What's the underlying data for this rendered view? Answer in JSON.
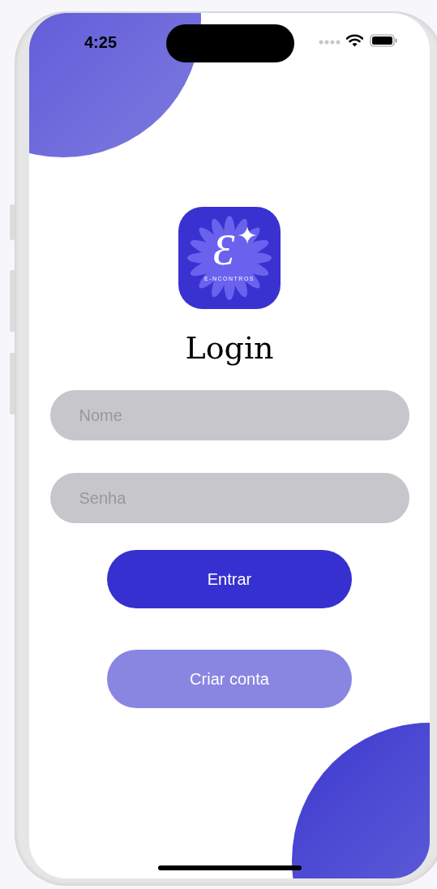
{
  "status_bar": {
    "time": "4:25"
  },
  "logo": {
    "letter": "Ɛ",
    "wordmark": "E-NCONTROS"
  },
  "title": "Login",
  "fields": [
    {
      "placeholder": "Nome"
    },
    {
      "placeholder": "Senha"
    }
  ],
  "buttons": [
    {
      "label": "Entrar",
      "kind": "primary"
    },
    {
      "label": "Criar conta",
      "kind": "secondary"
    }
  ]
}
